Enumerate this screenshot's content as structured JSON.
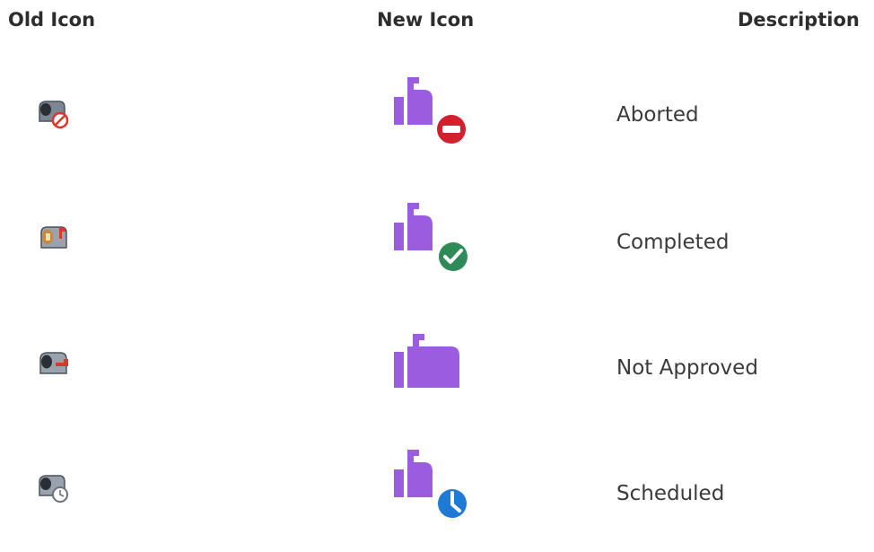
{
  "headers": {
    "old_icon": "Old Icon",
    "new_icon": "New Icon",
    "description": "Description"
  },
  "rows": [
    {
      "old_icon": "old-mailbox-aborted-icon",
      "new_icon": "mailbox-aborted-icon",
      "badge_color": "#d3202f",
      "description": "Aborted"
    },
    {
      "old_icon": "old-mailbox-completed-icon",
      "new_icon": "mailbox-completed-icon",
      "badge_color": "#2e8b57",
      "description": "Completed"
    },
    {
      "old_icon": "old-mailbox-not-approved-icon",
      "new_icon": "mailbox-not-approved-icon",
      "badge_color": "",
      "description": "Not Approved"
    },
    {
      "old_icon": "old-mailbox-scheduled-icon",
      "new_icon": "mailbox-scheduled-icon",
      "badge_color": "#1f7ad6",
      "description": "Scheduled"
    }
  ],
  "colors": {
    "mailbox_purple": "#9b5ce0",
    "header_text": "#2d2d2d",
    "body_text": "#3a3a3a"
  }
}
